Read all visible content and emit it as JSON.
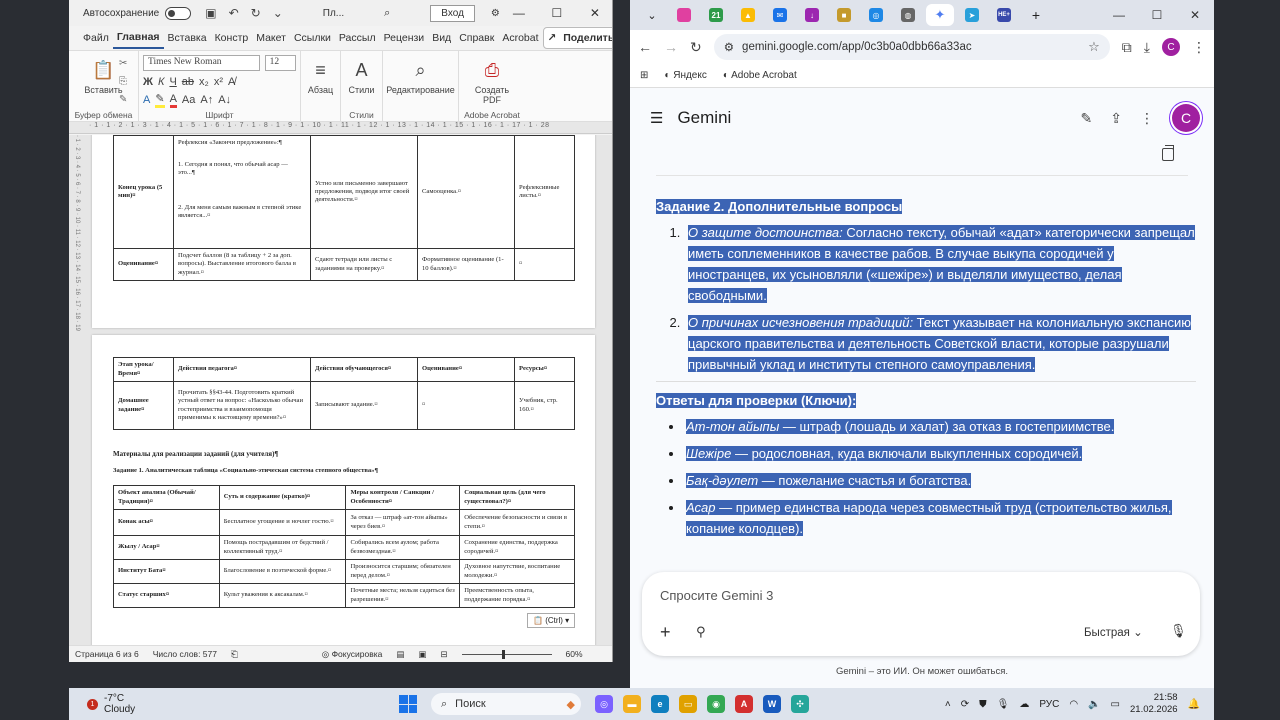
{
  "word": {
    "autosave_label": "Автосохранение",
    "doc_name": "Пл...",
    "signin": "Вход",
    "tabs": [
      "Файл",
      "Главная",
      "Вставка",
      "Констр",
      "Макет",
      "Ссылки",
      "Рассыл",
      "Рецензи",
      "Вид",
      "Справк",
      "Acrobat"
    ],
    "share": "Поделиться",
    "ribbon": {
      "paste": "Вставить",
      "clipboard": "Буфер обмена",
      "font_name": "Times New Roman",
      "font_size": "12",
      "font_group": "Шрифт",
      "paragraph": "Абзац",
      "styles": "Стили",
      "styles_group": "Стили",
      "editing": "Редактирование",
      "create_pdf": "Создать PDF",
      "acrobat_group": "Adobe Acrobat"
    },
    "ruler": "· 1 · 1 · 2 · 1 · 3 · 1 · 4 · 1 · 5 · 1 · 6 · 1 · 7 · 1 · 8 · 1 · 9 · 1 · 10 · 1 · 11 · 1 · 12 · 1 · 13 · 1 · 14 · 1 · 15 · 1 · 16 · 1 · 17 · 1 · 28",
    "page1": {
      "rows": [
        {
          "c1": "Конец урока (5 мин)¤",
          "c2_title": "Рефлексия «Закончи предложение»:¶",
          "c2_line1": "1. Сегодня я понял, что обычай асар — это...¶",
          "c2_line2": "2. Для меня самым важным в степной этике является...¤",
          "c3": "Устно или письменно завершают предложения, подводя итог своей деятельности.¤",
          "c4": "Самооценка.¤",
          "c5": "Рефлексивные листы.¤"
        },
        {
          "c1": "Оценивание¤",
          "c2": "Подсчет баллов (8 за таблицу + 2 за доп. вопросы). Выставление итогового балла в журнал.¤",
          "c3": "Сдают тетради или листы с заданиями на проверку.¤",
          "c4": "Формативное оценивание (1-10 баллов).¤",
          "c5": "¤"
        }
      ]
    },
    "page2": {
      "header": [
        "Этап урока/Время¤",
        "Действия педагога¤",
        "Действия обучающегося¤",
        "Оценивание¤",
        "Ресурсы¤"
      ],
      "homework": [
        "Домашнее задание¤",
        "Прочитать §§43-44. Подготовить краткий устный ответ на вопрос: «Насколько обычаи гостеприимства и взаимопомощи применимы к настоящему времени?»¤",
        "Записывают задание.¤",
        "¤",
        "Учебник, стр. 160.¤"
      ],
      "materials_title": "Материалы для реализации заданий (для учителя)¶",
      "task1_title": "Задание 1. Аналитическая таблица «Социально-этическая система степного общества»¶",
      "t2_header": [
        "Объект анализа (Обычай/Традиция)¤",
        "Суть и содержание (кратко)¤",
        "Меры контроля / Санкции / Особенности¤",
        "Социальная цель (для чего существовал?)¤"
      ],
      "t2_rows": [
        [
          "Конак асы¤",
          "Бесплатное угощение и ночлег гостю.¤",
          "За отказ — штраф «ат-тон айыпы» через биев.¤",
          "Обеспечение безопасности и связи в степи.¤"
        ],
        [
          "Жылу / Асар¤",
          "Помощь пострадавшим от бедствий / коллективный труд.¤",
          "Собирались всем аулом; работа безвозмездная.¤",
          "Сохранение единства, поддержка сородичей.¤"
        ],
        [
          "Институт Бата¤",
          "Благословение в поэтической форме.¤",
          "Произносится старшим; обязателен перед делом.¤",
          "Духовное напутствие, воспитание молодежи.¤"
        ],
        [
          "Статус старших¤",
          "Культ уважения к аксакалам.¤",
          "Почетные места; нельзя садиться без разрешения.¤",
          "Преемственность опыта, поддержание порядка.¤"
        ]
      ]
    },
    "paste_tag": "(Ctrl) ▾",
    "status": {
      "page": "Страница 6 из 6",
      "words": "Число слов: 577",
      "focus": "Фокусировка",
      "zoom": "60%"
    }
  },
  "chrome": {
    "url": "gemini.google.com/app/0c3b0a0dbb66a33ac",
    "bookmarks": [
      "Яндекс",
      "Adobe Acrobat"
    ],
    "avatar_letter": "С",
    "tab_labels": {
      "badge": "21",
      "new": "НЕ+"
    }
  },
  "gemini": {
    "title": "Gemini",
    "section2_title": "Задание 2. Дополнительные вопросы",
    "q1_label": "О защите достоинства:",
    "q1_text": " Согласно тексту, обычай «адат» категорически запрещал иметь соплеменников в качестве рабов. В случае выкупа сородичей у иностранцев, их усыновляли («шежіре») и выделяли имущество, делая свободными.",
    "q2_label": "О причинах исчезновения традиций:",
    "q2_text": " Текст указывает на колониальную экспансию царского правительства и деятельность Советской власти, которые разрушали привычный уклад и институты степного самоуправления.",
    "keys_title": "Ответы для проверки (Ключи):",
    "keys": [
      {
        "term": "Ат-тон айыпы",
        "def": " — штраф (лошадь и халат) за отказ в гостеприимстве."
      },
      {
        "term": "Шежіре",
        "def": " — родословная, куда включали выкупленных сородичей."
      },
      {
        "term": "Бақ-дәулет",
        "def": " — пожелание счастья и богатства."
      },
      {
        "term": "Асар",
        "def": " — пример единства народа через совместный труд (строительство жилья, копание колодцев)."
      }
    ],
    "input_placeholder": "Спросите Gemini 3",
    "mode": "Быстрая",
    "disclaimer": "Gemini – это ИИ. Он может ошибаться."
  },
  "taskbar": {
    "weather_temp": "-7°C",
    "weather_desc": "Cloudy",
    "weather_badge": "1",
    "search": "Поиск",
    "lang": "РУС",
    "time": "21:58",
    "date": "21.02.2026"
  }
}
